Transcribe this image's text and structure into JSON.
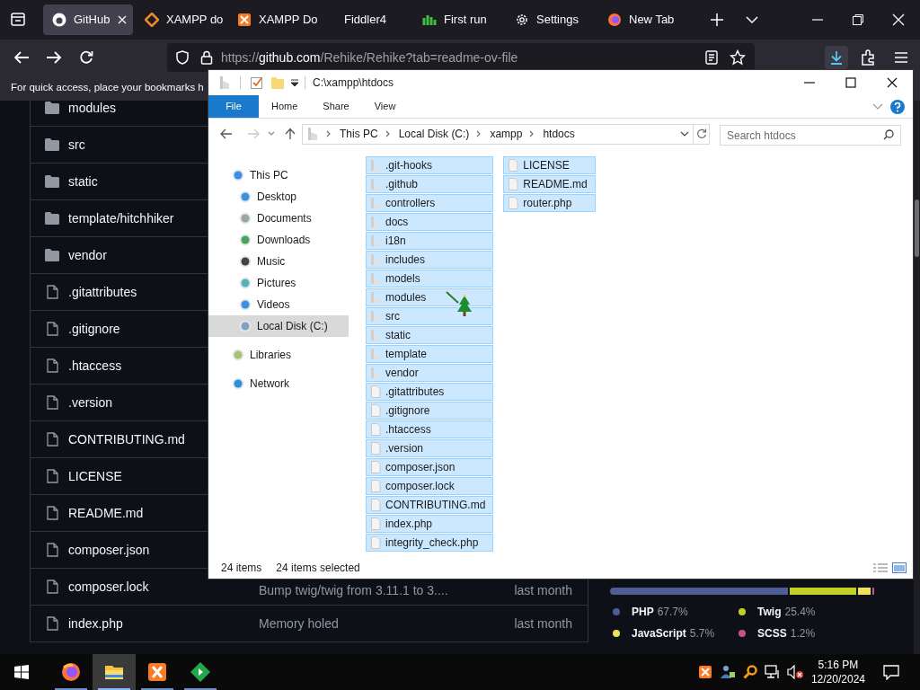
{
  "browser": {
    "tabs": [
      {
        "label": "GitHub",
        "kind": "github",
        "selected": true
      },
      {
        "label": "XAMPP do",
        "kind": "diamond",
        "selected": false
      },
      {
        "label": "XAMPP Do",
        "kind": "xampp",
        "selected": false
      },
      {
        "label": "Fiddler4",
        "kind": "plain",
        "selected": false
      },
      {
        "label": "First run",
        "kind": "bars",
        "selected": false
      },
      {
        "label": "Settings",
        "kind": "gear",
        "selected": false
      },
      {
        "label": "New Tab",
        "kind": "firefox",
        "selected": false
      }
    ],
    "url": {
      "scheme": "https://",
      "host": "github.com",
      "path": "/Rehike/Rehike?tab=readme-ov-file"
    },
    "bookmarks_hint": "For quick access, place your bookmarks h"
  },
  "repo_files": [
    {
      "name": "modules",
      "kind": "folder"
    },
    {
      "name": "src",
      "kind": "folder"
    },
    {
      "name": "static",
      "kind": "folder"
    },
    {
      "name": "template/hitchhiker",
      "kind": "folder"
    },
    {
      "name": "vendor",
      "kind": "folder"
    },
    {
      "name": ".gitattributes",
      "kind": "file"
    },
    {
      "name": ".gitignore",
      "kind": "file"
    },
    {
      "name": ".htaccess",
      "kind": "file"
    },
    {
      "name": ".version",
      "kind": "file"
    },
    {
      "name": "CONTRIBUTING.md",
      "kind": "file"
    },
    {
      "name": "LICENSE",
      "kind": "file"
    },
    {
      "name": "README.md",
      "kind": "file"
    },
    {
      "name": "composer.json",
      "kind": "file"
    },
    {
      "name": "composer.lock",
      "kind": "file",
      "message": "Bump twig/twig from 3.11.1 to 3....",
      "date": "last month"
    },
    {
      "name": "index.php",
      "kind": "file",
      "message": "Memory holed",
      "date": "last month"
    }
  ],
  "languages": [
    {
      "name": "PHP",
      "percent": "67.7%",
      "color": "#4f5d95"
    },
    {
      "name": "Twig",
      "percent": "25.4%",
      "color": "#c1d026"
    },
    {
      "name": "JavaScript",
      "percent": "5.7%",
      "color": "#f1e05a"
    },
    {
      "name": "SCSS",
      "percent": "1.2%",
      "color": "#c6538c"
    }
  ],
  "explorer": {
    "title": "C:\\xampp\\htdocs",
    "ribbon_tabs": [
      {
        "label": "File",
        "selected": true
      },
      {
        "label": "Home",
        "selected": false
      },
      {
        "label": "Share",
        "selected": false
      },
      {
        "label": "View",
        "selected": false
      }
    ],
    "breadcrumb": [
      "This PC",
      "Local Disk (C:)",
      "xampp",
      "htdocs"
    ],
    "search_placeholder": "Search htdocs",
    "nav": [
      {
        "label": "This PC",
        "kind": "pc",
        "selected": false,
        "children": [
          {
            "label": "Desktop",
            "kind": "desktop",
            "selected": false
          },
          {
            "label": "Documents",
            "kind": "documents",
            "selected": false
          },
          {
            "label": "Downloads",
            "kind": "downloads",
            "selected": false
          },
          {
            "label": "Music",
            "kind": "music",
            "selected": false
          },
          {
            "label": "Pictures",
            "kind": "pictures",
            "selected": false
          },
          {
            "label": "Videos",
            "kind": "videos",
            "selected": false
          },
          {
            "label": "Local Disk (C:)",
            "kind": "disk",
            "selected": true
          }
        ]
      },
      {
        "label": "Libraries",
        "kind": "libraries",
        "selected": false
      },
      {
        "label": "Network",
        "kind": "network",
        "selected": false
      }
    ],
    "items": [
      {
        "name": ".git-hooks",
        "kind": "folder",
        "selected": true
      },
      {
        "name": ".github",
        "kind": "folder",
        "selected": true
      },
      {
        "name": "controllers",
        "kind": "folder",
        "selected": true
      },
      {
        "name": "docs",
        "kind": "folder",
        "selected": true
      },
      {
        "name": "i18n",
        "kind": "folder",
        "selected": true
      },
      {
        "name": "includes",
        "kind": "folder",
        "selected": true
      },
      {
        "name": "models",
        "kind": "folder",
        "selected": true
      },
      {
        "name": "modules",
        "kind": "folder",
        "selected": true
      },
      {
        "name": "src",
        "kind": "folder",
        "selected": true
      },
      {
        "name": "static",
        "kind": "folder",
        "selected": true
      },
      {
        "name": "template",
        "kind": "folder",
        "selected": true
      },
      {
        "name": "vendor",
        "kind": "folder",
        "selected": true
      },
      {
        "name": ".gitattributes",
        "kind": "file",
        "selected": true
      },
      {
        "name": ".gitignore",
        "kind": "file",
        "selected": true
      },
      {
        "name": ".htaccess",
        "kind": "file",
        "selected": true
      },
      {
        "name": ".version",
        "kind": "file",
        "selected": true
      },
      {
        "name": "composer.json",
        "kind": "file",
        "selected": true
      },
      {
        "name": "composer.lock",
        "kind": "file",
        "selected": true
      },
      {
        "name": "CONTRIBUTING.md",
        "kind": "file",
        "selected": true
      },
      {
        "name": "index.php",
        "kind": "file",
        "selected": true
      },
      {
        "name": "integrity_check.php",
        "kind": "file",
        "selected": true
      },
      {
        "name": "LICENSE",
        "kind": "file",
        "selected": true
      },
      {
        "name": "README.md",
        "kind": "file",
        "selected": true
      },
      {
        "name": "router.php",
        "kind": "file",
        "selected": true
      }
    ],
    "status": {
      "count": "24 items",
      "selection": "24 items selected"
    }
  },
  "taskbar": {
    "apps": [
      {
        "kind": "firefox",
        "active": false
      },
      {
        "kind": "explorer",
        "active": true
      },
      {
        "kind": "xampp",
        "active": false
      },
      {
        "kind": "diamond",
        "active": false
      }
    ],
    "time": "5:16 PM",
    "date": "12/20/2024"
  }
}
